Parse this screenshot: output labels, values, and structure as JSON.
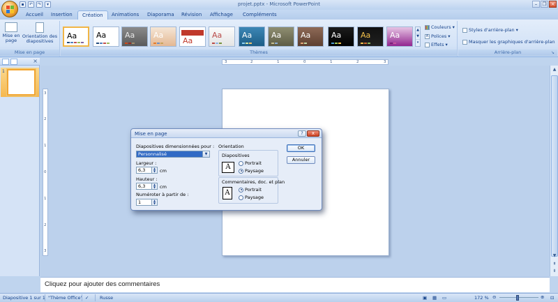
{
  "window": {
    "title": "projet.pptx - Microsoft PowerPoint"
  },
  "tabs": [
    "Accueil",
    "Insertion",
    "Création",
    "Animations",
    "Diaporama",
    "Révision",
    "Affichage",
    "Compléments"
  ],
  "active_tab": "Création",
  "ribbon": {
    "mise_en_page_group": {
      "label": "Mise en page",
      "btn_page_line1": "Mise en",
      "btn_page_line2": "page",
      "btn_orient_line1": "Orientation des",
      "btn_orient_line2": "diapositives"
    },
    "themes_group": {
      "label": "Thèmes",
      "theme_sample_text": "Aa",
      "couleurs": "Couleurs",
      "polices": "Polices",
      "effets": "Effets"
    },
    "arriere_plan_group": {
      "label": "Arrière-plan",
      "styles": "Styles d'arrière-plan",
      "masquer": "Masquer les graphiques d'arrière-plan"
    }
  },
  "ruler": {
    "h": [
      "3",
      "2",
      "1",
      "0",
      "1",
      "2",
      "3"
    ],
    "v": [
      "3",
      "2",
      "1",
      "0",
      "1",
      "2",
      "3"
    ]
  },
  "slide_panel": {
    "slide_number": "1"
  },
  "notes": {
    "placeholder": "Cliquez pour ajouter des commentaires"
  },
  "status": {
    "slide": "Diapositive 1 sur 1",
    "theme": "\"Thème Office\"",
    "language": "Russe",
    "zoom": "172 %"
  },
  "dialog": {
    "title": "Mise en page",
    "size_label": "Diapositives dimensionnées pour :",
    "size_value": "Personnalisé",
    "width_label": "Largeur :",
    "width_value": "6,3",
    "width_unit": "cm",
    "height_label": "Hauteur :",
    "height_value": "6,3",
    "height_unit": "cm",
    "numbering_label": "Numéroter à partir de :",
    "numbering_value": "1",
    "orientation_label": "Orientation",
    "slides_label": "Diapositives",
    "slides_portrait": "Portrait",
    "slides_paysage": "Paysage",
    "slides_selected": "Paysage",
    "notes_label": "Commentaires, doc. et plan",
    "notes_portrait": "Portrait",
    "notes_paysage": "Paysage",
    "notes_selected": "Portrait",
    "ok": "OK",
    "cancel": "Annuler",
    "help": "?",
    "close": "x"
  }
}
